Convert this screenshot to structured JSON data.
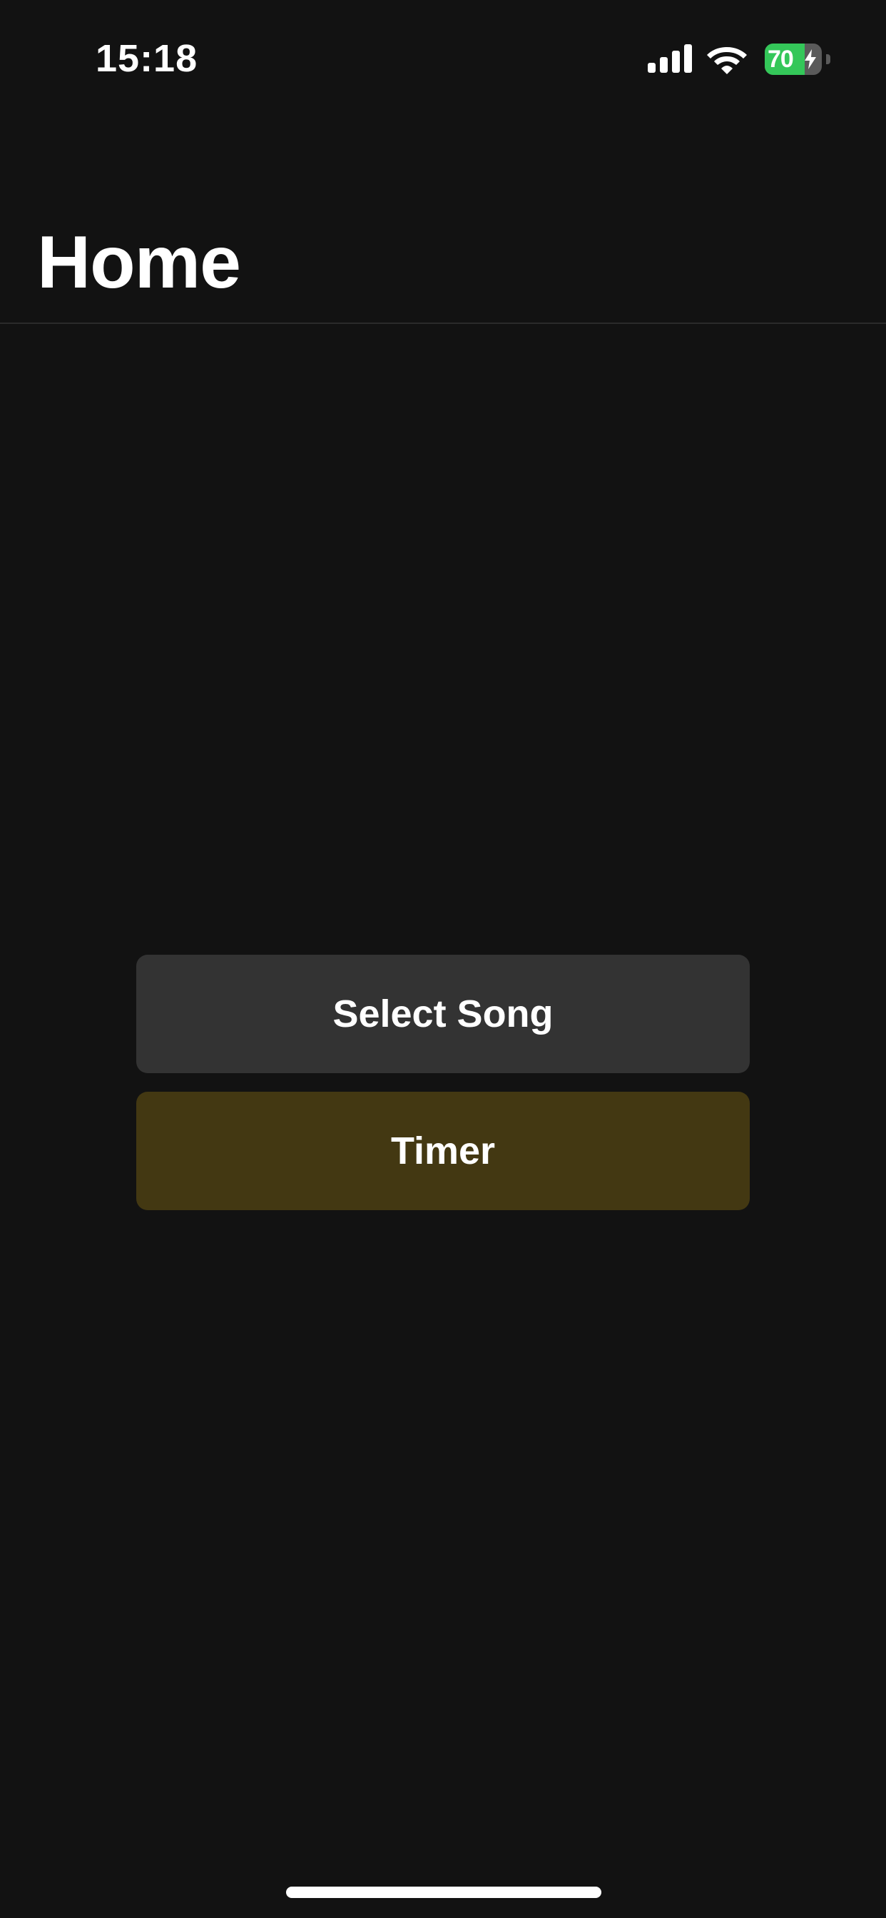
{
  "status_bar": {
    "time": "15:18",
    "battery_level": "70",
    "battery_fraction": 0.7,
    "battery_charging": true,
    "signal_icon": "cellular-signal-icon",
    "wifi_icon": "wifi-icon",
    "bolt_icon": "charging-bolt-icon"
  },
  "header": {
    "title": "Home"
  },
  "main": {
    "select_song_label": "Select Song",
    "timer_label": "Timer"
  },
  "colors": {
    "background": "#121212",
    "select_song_button": "#333333",
    "timer_button": "#433812",
    "battery_fill": "#34c759"
  }
}
